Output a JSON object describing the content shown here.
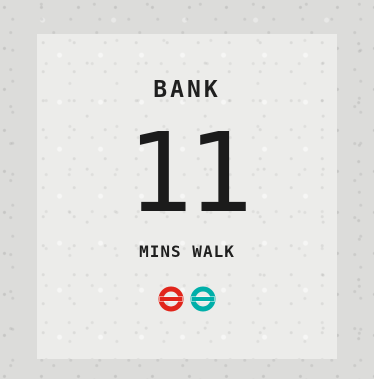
{
  "tile": {
    "station": "BANK",
    "minutes": "11",
    "unit_label": "MINS WALK"
  },
  "lines": [
    {
      "icon": "underground-roundel-icon",
      "color": "#e1251b"
    },
    {
      "icon": "dlr-roundel-icon",
      "color": "#00afa9"
    }
  ]
}
